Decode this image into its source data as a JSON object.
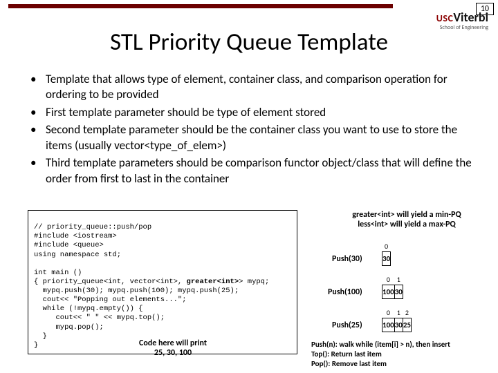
{
  "page_number": "10",
  "logo": {
    "usc": "USC",
    "viterbi": "Viterbi",
    "sub": "School of Engineering"
  },
  "title": "STL Priority Queue Template",
  "bullets": {
    "b1": "Template that allows type of element, container class, and comparison operation for ordering to be provided",
    "b2": "First template parameter should be type of element stored",
    "b3": "Second template parameter should be the container class you want to use to store the items (usually vector<type_of_elem>)",
    "b4": "Third template parameters should be comparison functor object/class that will define the order from first to last in the container"
  },
  "code": {
    "l0": "// priority_queue::push/pop",
    "l1": "#include <iostream>",
    "l2": "#include <queue>",
    "l3": "using namespace std;",
    "l4": "",
    "l5": "int main ()",
    "l6a": "{ priority_queue<int, vector<int>, ",
    "l6b": "greater<int>",
    "l6c": "> mypq;",
    "l7": "  mypq.push(30); mypq.push(100); mypq.push(25);",
    "l8": "  cout<< \"Popping out elements...\";",
    "l9": "  while (!mypq.empty()) {",
    "l10": "     cout<< \" \" << mypq.top();",
    "l11": "     mypq.pop();",
    "l12": "  }",
    "l13": "}"
  },
  "caption": {
    "l1": "Code here will print",
    "l2": "25, 30, 100"
  },
  "note": {
    "l1": "greater<int> will yield a min-PQ",
    "l2": "less<int> will yield a max-PQ"
  },
  "heap": {
    "idx0": "0",
    "idx1": "1",
    "idx2": "2",
    "v30": "30",
    "v100": "100",
    "v25": "25",
    "push30": "Push(30)",
    "push100": "Push(100)",
    "push25": "Push(25)"
  },
  "footnote": {
    "l1": "Push(n): walk while (item[i] > n), then insert",
    "l2": "Top(): Return last item",
    "l3": "Pop(): Remove last item"
  }
}
